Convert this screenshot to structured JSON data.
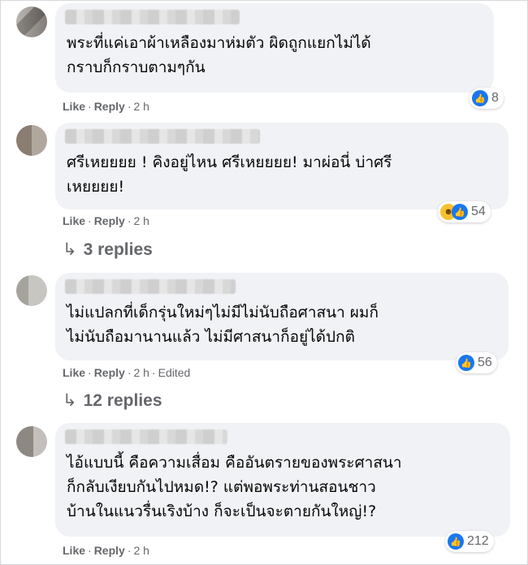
{
  "comments": [
    {
      "text": "พระที่แค่เอาผ้าเหลืองมาห่มตัว ผิดถูกแยกไม่ได้\nกราบก็กราบตามๆกัน",
      "like": "Like",
      "reply": "Reply",
      "time": "2 h",
      "reaction_count": "8"
    },
    {
      "text": "ศรีเหยยยย ! คิงอยู่ไหน ศรีเหยยยย! มาผ่อนี่ บ่าศรี\nเหยยยย!",
      "like": "Like",
      "reply": "Reply",
      "time": "2 h",
      "reaction_count": "54",
      "replies": "3 replies"
    },
    {
      "text": "ไม่แปลกที่เด็กรุ่นใหม่ๆไม่มีไม่นับถือศาสนา ผมก็\nไม่นับถือมานานแล้ว ไม่มีศาสนาก็อยู่ได้ปกติ",
      "like": "Like",
      "reply": "Reply",
      "time": "2 h",
      "edited": "Edited",
      "reaction_count": "56",
      "replies": "12 replies"
    },
    {
      "text": "ไอ้แบบนี้ คือความเสื่อม คืออันตรายของพระศาสนา\nก็กลับเงียบกันไปหมด!? แต่พอพระท่านสอนชาว\nบ้านในแนวรื่นเริงบ้าง ก็จะเป็นจะตายกันใหญ่!?",
      "like": "Like",
      "reply": "Reply",
      "time": "2 h",
      "reaction_count": "212"
    }
  ],
  "icons": {
    "like": "thumbs-up-icon",
    "haha": "laughing-face-icon",
    "reply_arrow": "reply-arrow-icon"
  },
  "colors": {
    "bubble": "#f0f2f5",
    "meta": "#65676b",
    "like_blue": "#1877f2",
    "haha_yellow": "#f7c130"
  }
}
